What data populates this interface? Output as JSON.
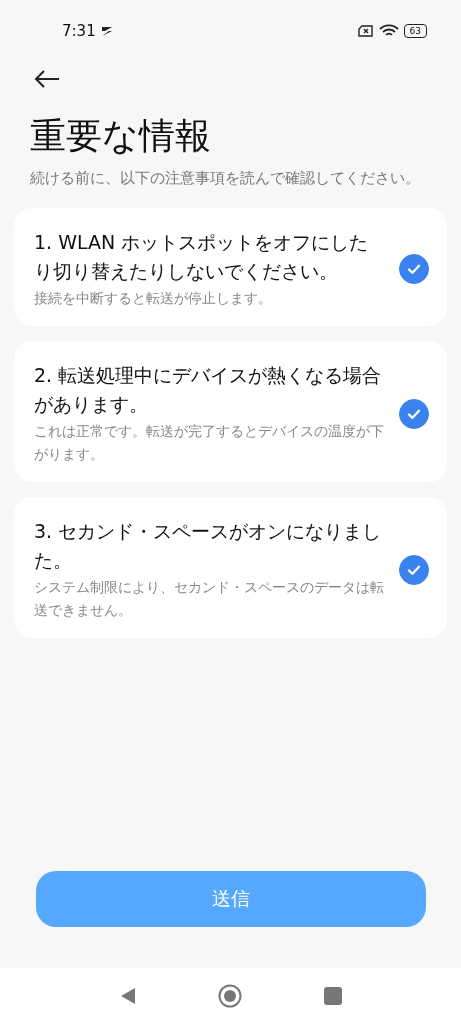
{
  "status_bar": {
    "time": "7:31",
    "battery": "63"
  },
  "title": "重要な情報",
  "subtitle": "続ける前に、以下の注意事項を読んで確認してください。",
  "items": [
    {
      "title": "1. WLAN ホットスポットをオフにしたり切り替えたりしないでください。",
      "description": "接続を中断すると転送が停止します。",
      "checked": true
    },
    {
      "title": "2. 転送処理中にデバイスが熱くなる場合があります。",
      "description": "これは正常です。転送が完了するとデバイスの温度が下がります。",
      "checked": true
    },
    {
      "title": "3. セカンド・スペースがオンになりました。",
      "description": "システム制限により、セカンド・スペースのデータは転送できません。",
      "checked": true
    }
  ],
  "button": "送信"
}
